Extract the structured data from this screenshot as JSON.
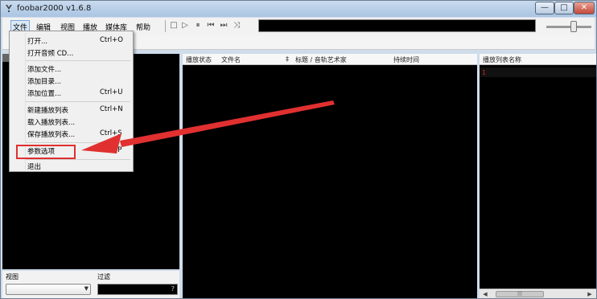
{
  "window": {
    "title": "foobar2000 v1.6.8",
    "minimize": "—",
    "maximize": "□",
    "close": "✕"
  },
  "menu": [
    "文件",
    "编辑",
    "视图",
    "播放",
    "媒体库",
    "帮助"
  ],
  "toolbar": {
    "stop": "□",
    "play": "▷",
    "pause": "⏸",
    "prev": "⏮",
    "next": "⏭",
    "random": "⤨"
  },
  "file_menu": [
    {
      "label": "打开...",
      "shortcut": "Ctrl+O"
    },
    {
      "label": "打开音频 CD...",
      "shortcut": ""
    },
    {
      "label": "添加文件...",
      "shortcut": ""
    },
    {
      "label": "添加目录...",
      "shortcut": ""
    },
    {
      "label": "添加位置...",
      "shortcut": "Ctrl+U"
    },
    {
      "label": "新建播放列表",
      "shortcut": "Ctrl+N"
    },
    {
      "label": "载入播放列表...",
      "shortcut": ""
    },
    {
      "label": "保存播放列表...",
      "shortcut": "Ctrl+S"
    },
    {
      "label": "参数选项",
      "shortcut": "Ctrl+P"
    },
    {
      "label": "退出",
      "shortcut": ""
    }
  ],
  "playlist_columns": [
    "播放状态",
    "文件名",
    "‡",
    "标题 / 音轨艺术家",
    "持续时间"
  ],
  "playlist_manager": {
    "header": "播放列表名称",
    "row_index": "1"
  },
  "bottom": {
    "view_label": "视图",
    "filter_label": "过滤",
    "filter_q": "?"
  },
  "colors": {
    "annotation": "#e03030",
    "pane_bg": "#000000"
  }
}
